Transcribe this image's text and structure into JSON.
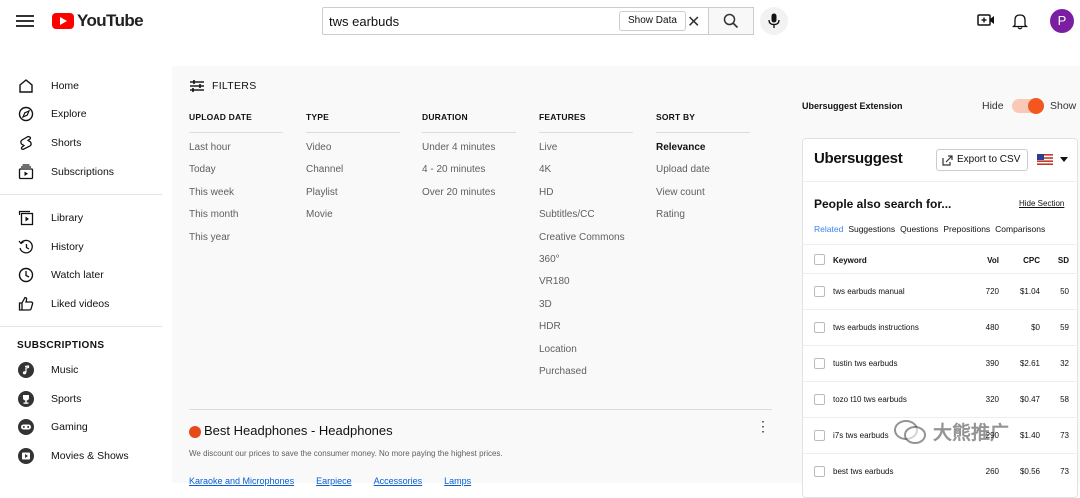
{
  "header": {
    "logo_text": "YouTube",
    "search_value": "tws earbuds",
    "show_data_label": "Show Data",
    "avatar_letter": "P"
  },
  "sidebar": {
    "items": [
      {
        "label": "Home",
        "icon": "home-icon"
      },
      {
        "label": "Explore",
        "icon": "compass-icon"
      },
      {
        "label": "Shorts",
        "icon": "shorts-icon"
      },
      {
        "label": "Subscriptions",
        "icon": "subscriptions-icon"
      },
      {
        "label": "Library",
        "icon": "library-icon"
      },
      {
        "label": "History",
        "icon": "history-icon"
      },
      {
        "label": "Watch later",
        "icon": "clock-icon"
      },
      {
        "label": "Liked videos",
        "icon": "thumbs-up-icon"
      }
    ],
    "subscriptions_heading": "SUBSCRIPTIONS",
    "subscriptions": [
      {
        "label": "Music",
        "icon": "music-icon"
      },
      {
        "label": "Sports",
        "icon": "trophy-icon"
      },
      {
        "label": "Gaming",
        "icon": "gamepad-icon"
      },
      {
        "label": "Movies & Shows",
        "icon": "film-icon"
      }
    ]
  },
  "filters": {
    "title": "FILTERS",
    "columns": [
      {
        "heading": "UPLOAD DATE",
        "items": [
          "Last hour",
          "Today",
          "This week",
          "This month",
          "This year"
        ]
      },
      {
        "heading": "TYPE",
        "items": [
          "Video",
          "Channel",
          "Playlist",
          "Movie"
        ]
      },
      {
        "heading": "DURATION",
        "items": [
          "Under 4 minutes",
          "4 - 20 minutes",
          "Over 20 minutes"
        ]
      },
      {
        "heading": "FEATURES",
        "items": [
          "Live",
          "4K",
          "HD",
          "Subtitles/CC",
          "Creative Commons",
          "360°",
          "VR180",
          "3D",
          "HDR",
          "Location",
          "Purchased"
        ]
      },
      {
        "heading": "SORT BY",
        "items": [
          "Relevance",
          "Upload date",
          "View count",
          "Rating"
        ],
        "selected": "Relevance"
      }
    ]
  },
  "ad": {
    "title": "Best Headphones - Headphones",
    "description": "We discount our prices to save the consumer money. No more paying the highest prices.",
    "links": [
      "Karaoke and Microphones",
      "Earpiece",
      "Accessories",
      "Lamps"
    ]
  },
  "ubersuggest": {
    "extension_label": "Ubersuggest Extension",
    "hide_label": "Hide",
    "show_label": "Show",
    "toggle_on": true,
    "brand": "Ubersuggest",
    "export_label": "Export to CSV",
    "section_title": "People also search for...",
    "hide_section_label": "Hide Section",
    "tabs": [
      "Related",
      "Suggestions",
      "Questions",
      "Prepositions",
      "Comparisons"
    ],
    "active_tab": "Related",
    "columns": {
      "keyword": "Keyword",
      "vol": "Vol",
      "cpc": "CPC",
      "sd": "SD"
    },
    "rows": [
      {
        "keyword": "tws earbuds manual",
        "vol": "720",
        "cpc": "$1.04",
        "sd": "50"
      },
      {
        "keyword": "tws earbuds instructions",
        "vol": "480",
        "cpc": "$0",
        "sd": "59"
      },
      {
        "keyword": "tustin tws earbuds",
        "vol": "390",
        "cpc": "$2.61",
        "sd": "32"
      },
      {
        "keyword": "tozo t10 tws earbuds",
        "vol": "320",
        "cpc": "$0.47",
        "sd": "58"
      },
      {
        "keyword": "i7s tws earbuds",
        "vol": "290",
        "cpc": "$1.40",
        "sd": "73"
      },
      {
        "keyword": "best tws earbuds",
        "vol": "260",
        "cpc": "$0.56",
        "sd": "73"
      }
    ]
  },
  "watermark": {
    "text": "大熊推广"
  },
  "colors": {
    "yt_red": "#ff0000",
    "accent_orange": "#f3571f",
    "link_blue": "#065fd4",
    "tab_blue": "#3b82f6"
  }
}
